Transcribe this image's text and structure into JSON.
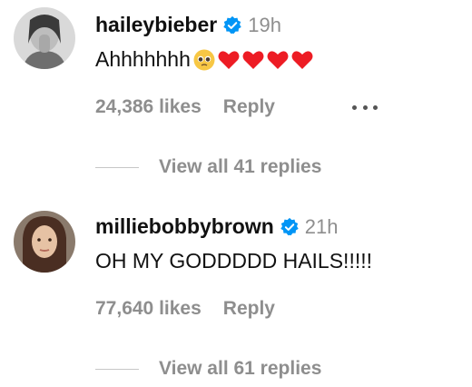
{
  "comments": [
    {
      "username": "haileybieber",
      "time": "19h",
      "text": "Ahhhhhhh",
      "emoji": [
        "pleading-face",
        "red-heart",
        "red-heart",
        "red-heart",
        "red-heart"
      ],
      "likes": "24,386 likes",
      "reply_label": "Reply",
      "view_replies": "View all 41 replies"
    },
    {
      "username": "milliebobbybrown",
      "time": "21h",
      "text": "OH MY GODDDDD HAILS!!!!!",
      "likes": "77,640 likes",
      "reply_label": "Reply",
      "view_replies": "View all 61 replies"
    }
  ],
  "colors": {
    "verified": "#0095f6",
    "secondary_text": "#8e8e8e",
    "heart": "#ed1c24"
  }
}
